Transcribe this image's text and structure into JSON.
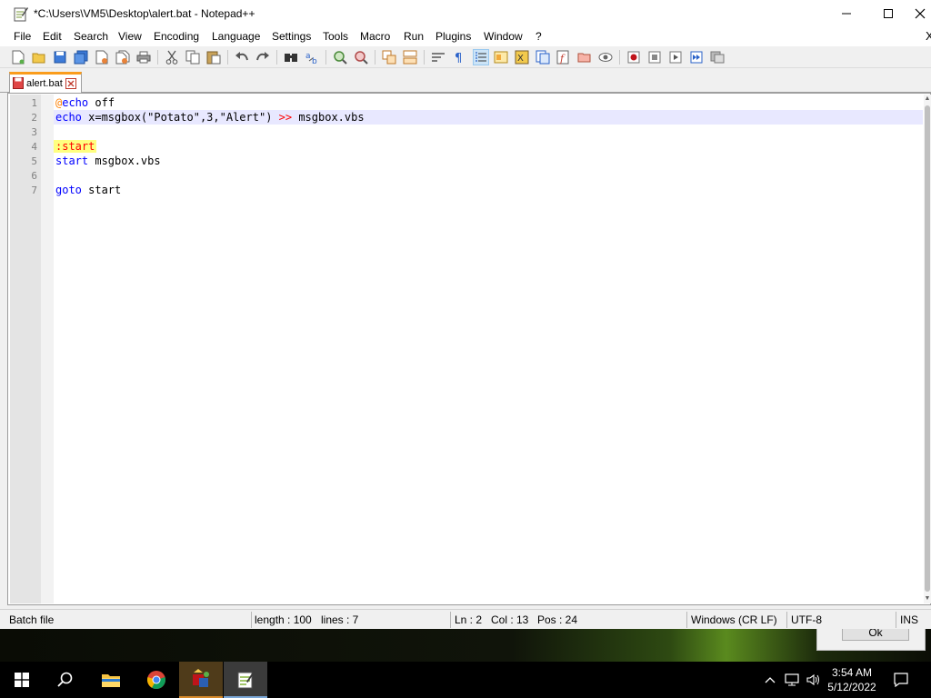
{
  "window": {
    "title": "*C:\\Users\\VM5\\Desktop\\alert.bat - Notepad++",
    "minimize": "—",
    "maximize": "☐",
    "close": "✕"
  },
  "menu": {
    "items": [
      "File",
      "Edit",
      "Search",
      "View",
      "Encoding",
      "Language",
      "Settings",
      "Tools",
      "Macro",
      "Run",
      "Plugins",
      "Window",
      "?"
    ],
    "close_doc": "X"
  },
  "toolbar_icons": [
    "new-file-icon",
    "open-file-icon",
    "save-icon",
    "save-all-icon",
    "close-icon",
    "close-all-icon",
    "print-icon",
    "cut-icon",
    "copy-icon",
    "paste-icon",
    "undo-icon",
    "redo-icon",
    "find-icon",
    "replace-icon",
    "zoom-in-icon",
    "zoom-out-icon",
    "sync-vertical-icon",
    "sync-horizontal-icon",
    "word-wrap-icon",
    "show-all-chars-icon",
    "indent-guide-icon",
    "udl-icon",
    "doc-map-icon",
    "doc-list-icon",
    "function-list-icon",
    "folder-workspace-icon",
    "monitoring-icon",
    "record-macro-icon",
    "stop-record-icon",
    "play-macro-icon",
    "run-macro-multiple-icon",
    "save-macro-icon"
  ],
  "tab": {
    "label": "alert.bat",
    "color": "#fa9c1c"
  },
  "editor": {
    "line_numbers": [
      "1",
      "2",
      "3",
      "4",
      "5",
      "6",
      "7"
    ],
    "lines": {
      "l1_at": "@",
      "l1_kw": "echo",
      "l1_rest": " off",
      "l2_kw": "echo",
      "l2_mid": " x=msgbox(\"Potato\",3,\"Alert\") ",
      "l2_op": ">>",
      "l2_rest": " msgbox.vbs",
      "l4_label": ":start",
      "l5_kw": "start",
      "l5_rest": " msgbox.vbs",
      "l7_kw": "goto",
      "l7_rest": " start"
    },
    "current_line_color": "#e8e8ff"
  },
  "status": {
    "file_type": "Batch file",
    "length": "length : 100",
    "lines": "lines : 7",
    "ln": "Ln : 2",
    "col": "Col : 13",
    "pos": "Pos : 24",
    "eol": "Windows (CR LF)",
    "encoding": "UTF-8",
    "mode": "INS"
  },
  "background_dialog": {
    "ok": "Ok"
  },
  "taskbar": {
    "apps": [
      "start-icon",
      "search-icon",
      "file-explorer-icon",
      "chrome-icon",
      "batch-app-icon",
      "notepadpp-icon"
    ],
    "time": "3:54 AM",
    "date": "5/12/2022"
  }
}
